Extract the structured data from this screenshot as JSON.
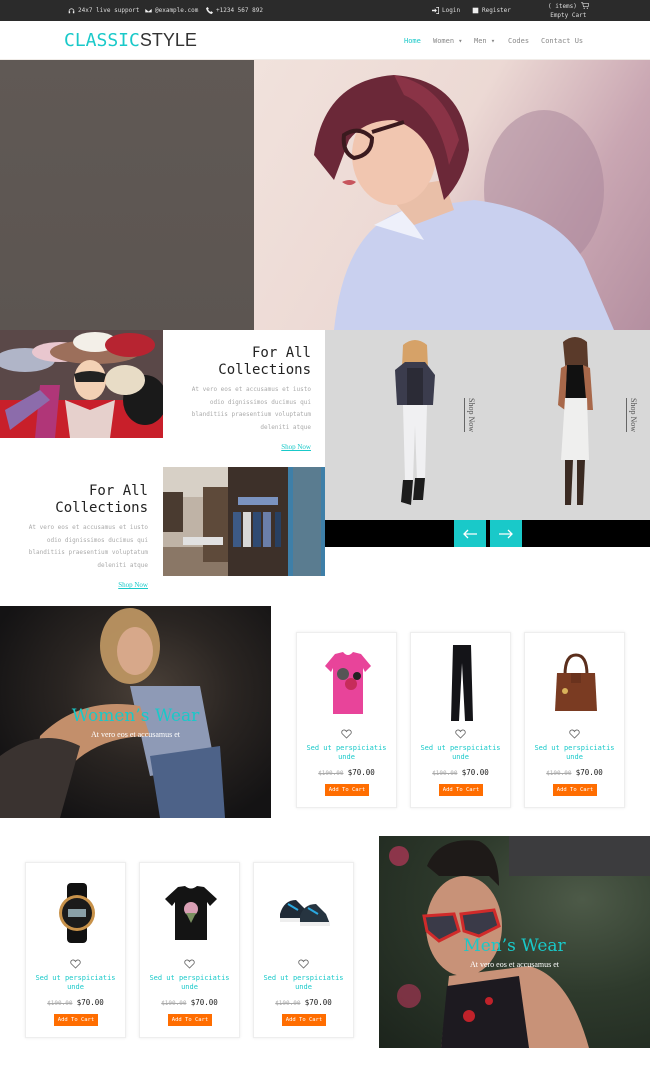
{
  "topbar": {
    "support": "24x7 live support",
    "email": "@example.com",
    "phone": "+1234 567 892",
    "login": "Login",
    "register": "Register",
    "cart_items": "( items)",
    "cart_status": "Empty Cart"
  },
  "header": {
    "logo_part1": "CLASSIC",
    "logo_part2": "STYLE",
    "nav": [
      {
        "label": "Home",
        "active": true
      },
      {
        "label": "Women ▾",
        "active": false
      },
      {
        "label": "Men ▾",
        "active": false
      },
      {
        "label": "Codes",
        "active": false
      },
      {
        "label": "Contact Us",
        "active": false
      }
    ]
  },
  "collections": [
    {
      "title_line1": "For All",
      "title_line2": "Collections",
      "text": [
        "At vero eos et accusamus et iusto",
        "odio dignissimos ducimus qui",
        "blanditiis praesentium voluptatum",
        "deleniti atque"
      ],
      "link": "Shop Now"
    },
    {
      "title_line1": "For All",
      "title_line2": "Collections",
      "text": [
        "At vero eos et accusamus et iusto",
        "odio dignissimos ducimus qui",
        "blanditiis praesentium voluptatum",
        "deleniti atque"
      ],
      "link": "Shop Now"
    }
  ],
  "slider": {
    "slides": [
      {
        "label": "Shop Now"
      },
      {
        "label": "Shop Now"
      }
    ],
    "prev": "←",
    "next": "→"
  },
  "womens": {
    "title": "Women’s Wear",
    "subtitle": "At vero eos et accusamus et",
    "products": [
      {
        "name": "Sed ut perspiciatis unde",
        "old_price": "$100.00",
        "price": "$70.00",
        "button": "Add To Cart",
        "image": "pink-tshirt"
      },
      {
        "name": "Sed ut perspiciatis unde",
        "old_price": "$100.00",
        "price": "$70.00",
        "button": "Add To Cart",
        "image": "black-jeans"
      },
      {
        "name": "Sed ut perspiciatis unde",
        "old_price": "$100.00",
        "price": "$70.00",
        "button": "Add To Cart",
        "image": "brown-handbag"
      }
    ]
  },
  "mens": {
    "title": "Men’s Wear",
    "subtitle": "At vero eos et accusamus et",
    "products": [
      {
        "name": "Sed ut perspiciatis unde",
        "old_price": "$100.00",
        "price": "$70.00",
        "button": "Add To Cart",
        "image": "watch"
      },
      {
        "name": "Sed ut perspiciatis unde",
        "old_price": "$100.00",
        "price": "$70.00",
        "button": "Add To Cart",
        "image": "black-tshirt"
      },
      {
        "name": "Sed ut perspiciatis unde",
        "old_price": "$100.00",
        "price": "$70.00",
        "button": "Add To Cart",
        "image": "sneakers"
      }
    ]
  },
  "colors": {
    "accent": "#19c9c9",
    "cta": "#ff6d00",
    "topbar": "#2b2b2b"
  }
}
